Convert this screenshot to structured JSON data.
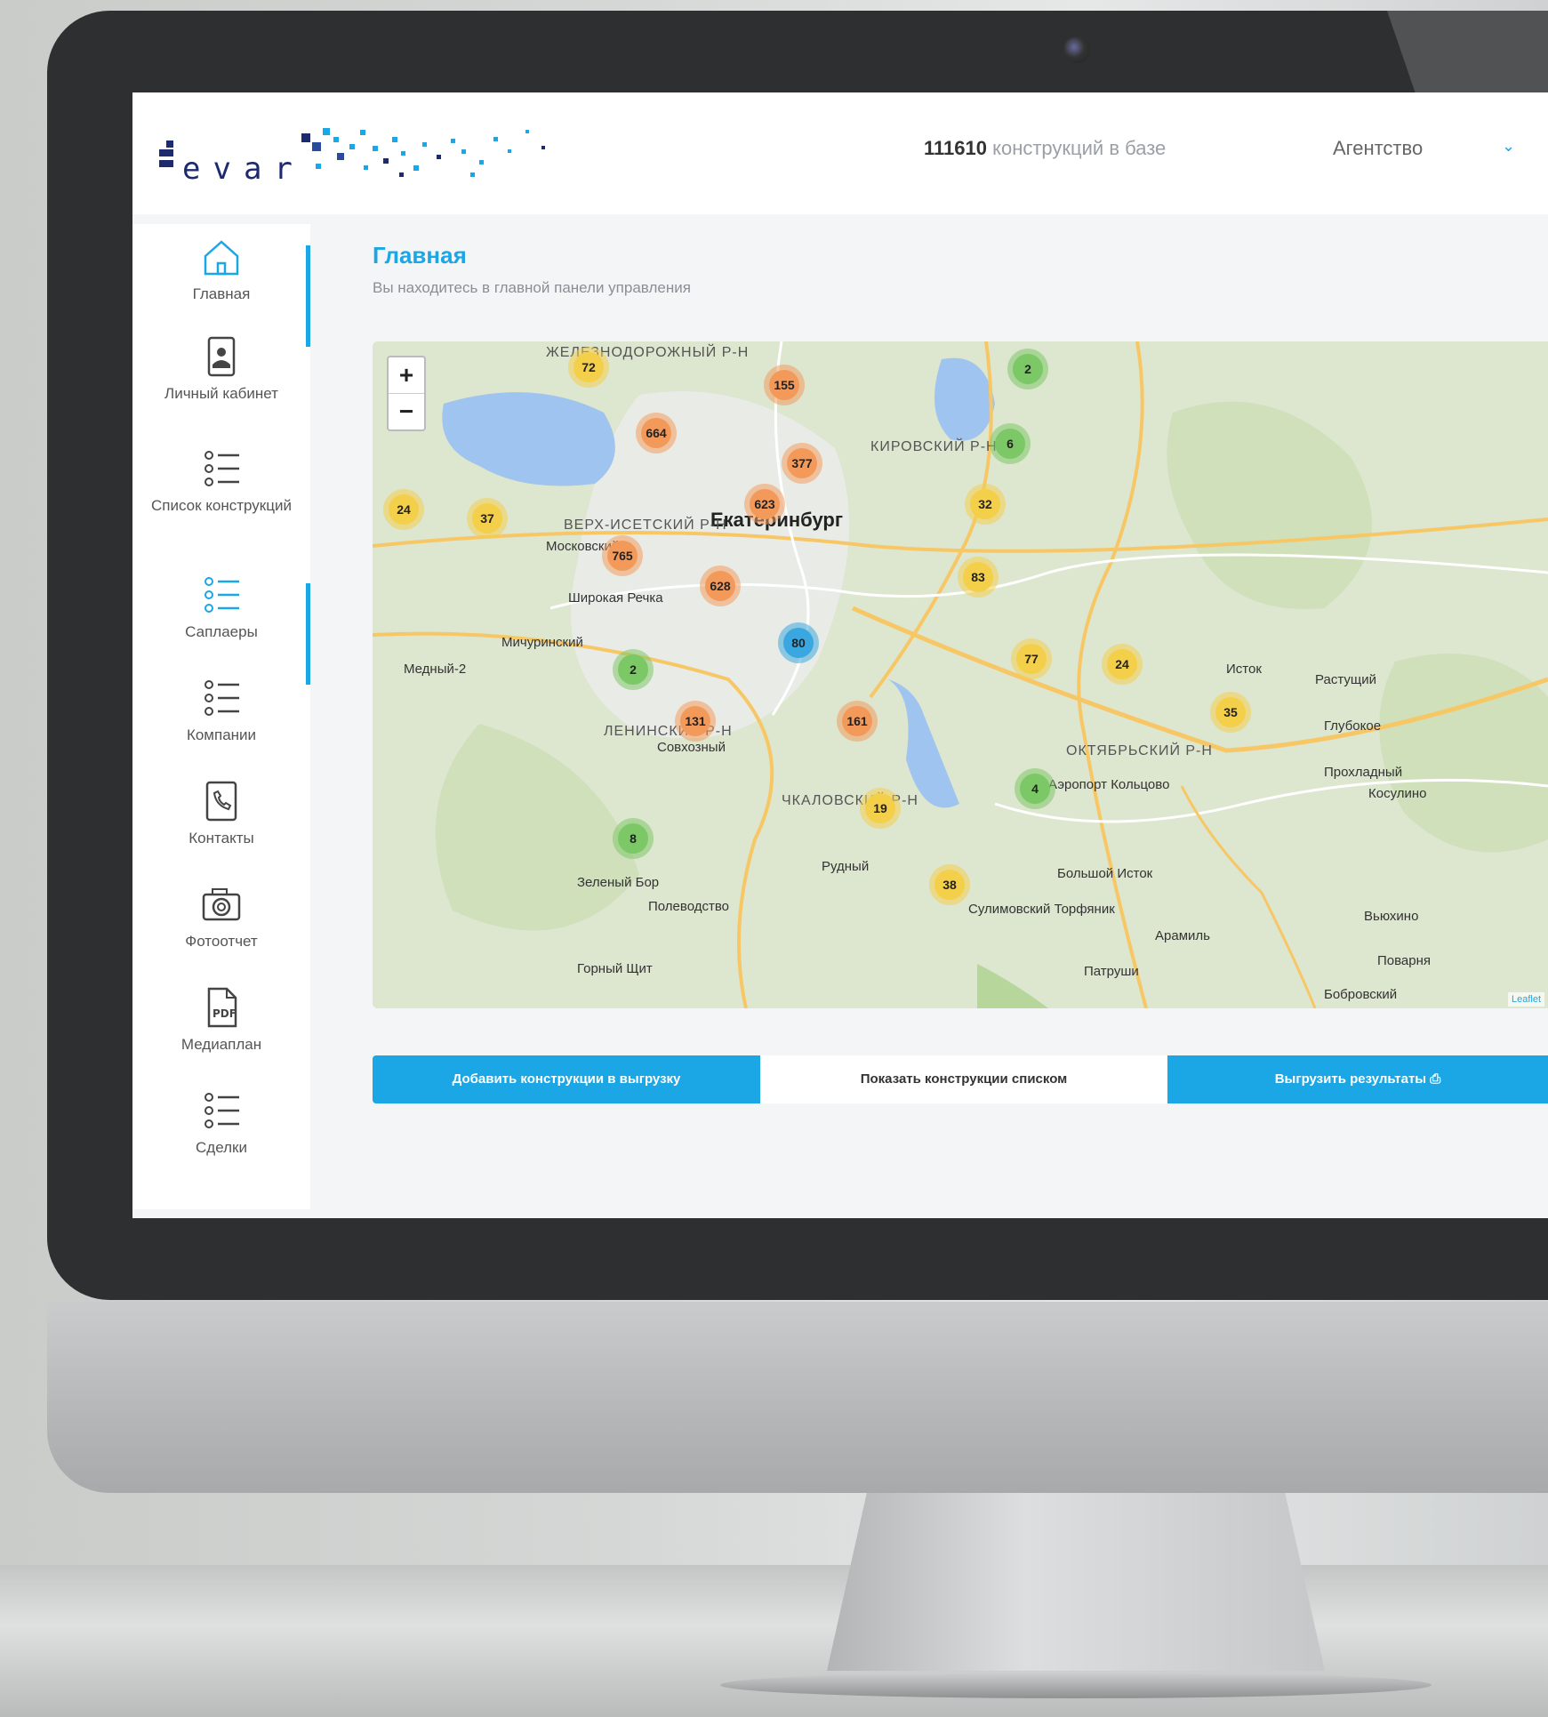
{
  "header": {
    "logo_text": "evar",
    "count_value": "111610",
    "count_label": " конструкций в базе",
    "account_label": "Агентство"
  },
  "sidebar": {
    "items": [
      {
        "label": "Главная",
        "icon": "home-icon",
        "active": true
      },
      {
        "label": "Личный кабинет",
        "icon": "profile-icon"
      },
      {
        "label": "Список конструкций",
        "icon": "checklist-icon"
      },
      {
        "label": "Саплаеры",
        "icon": "checklist-icon",
        "active": true
      },
      {
        "label": "Компании",
        "icon": "checklist-icon"
      },
      {
        "label": "Контакты",
        "icon": "phone-book-icon"
      },
      {
        "label": "Фотоотчет",
        "icon": "camera-icon"
      },
      {
        "label": "Медиаплан",
        "icon": "pdf-icon"
      },
      {
        "label": "Сделки",
        "icon": "checklist-icon"
      }
    ]
  },
  "page": {
    "title": "Главная",
    "subtitle": "Вы находитесь в главной панели управления"
  },
  "map": {
    "zoom_in": "+",
    "zoom_out": "−",
    "attribution": "Leaflet",
    "labels": [
      {
        "text": "Екатеринбург",
        "kind": "big"
      },
      {
        "text": "ЖЕЛЕЗНОДОРОЖНЫЙ Р-Н",
        "kind": "district"
      },
      {
        "text": "КИРОВСКИЙ Р-Н",
        "kind": "district"
      },
      {
        "text": "ВЕРХ-ИСЕТСКИЙ Р-Н",
        "kind": "district"
      },
      {
        "text": "ЛЕНИНСКИЙ Р-Н",
        "kind": "district"
      },
      {
        "text": "ЧКАЛОВСКИЙ Р-Н",
        "kind": "district"
      },
      {
        "text": "ОКТЯБРЬСКИЙ Р-Н",
        "kind": "district"
      },
      {
        "text": "Московский",
        "kind": "town"
      },
      {
        "text": "Широкая Речка",
        "kind": "town"
      },
      {
        "text": "Мичуринский",
        "kind": "town"
      },
      {
        "text": "Медный-2",
        "kind": "town"
      },
      {
        "text": "Совхозный",
        "kind": "town"
      },
      {
        "text": "Рудный",
        "kind": "town"
      },
      {
        "text": "Зеленый Бор",
        "kind": "town"
      },
      {
        "text": "Полеводство",
        "kind": "town"
      },
      {
        "text": "Горный Щит",
        "kind": "town"
      },
      {
        "text": "Аэропорт Кольцово",
        "kind": "town"
      },
      {
        "text": "Большой Исток",
        "kind": "town"
      },
      {
        "text": "Сулимовский Торфяник",
        "kind": "town"
      },
      {
        "text": "Арамиль",
        "kind": "town"
      },
      {
        "text": "Патруши",
        "kind": "town"
      },
      {
        "text": "Исток",
        "kind": "town"
      },
      {
        "text": "Растущий",
        "kind": "town"
      },
      {
        "text": "Глубокое",
        "kind": "town"
      },
      {
        "text": "Прохладный",
        "kind": "town"
      },
      {
        "text": "Косулино",
        "kind": "town"
      },
      {
        "text": "Вьюхино",
        "kind": "town"
      },
      {
        "text": "Поварня",
        "kind": "town"
      },
      {
        "text": "Бобровский",
        "kind": "town"
      }
    ],
    "clusters": [
      {
        "value": "72",
        "color": "yellow"
      },
      {
        "value": "155",
        "color": "orange"
      },
      {
        "value": "664",
        "color": "orange"
      },
      {
        "value": "377",
        "color": "orange"
      },
      {
        "value": "623",
        "color": "orange"
      },
      {
        "value": "24",
        "color": "yellow"
      },
      {
        "value": "37",
        "color": "yellow"
      },
      {
        "value": "765",
        "color": "orange"
      },
      {
        "value": "628",
        "color": "orange"
      },
      {
        "value": "80",
        "color": "blue"
      },
      {
        "value": "2",
        "color": "green"
      },
      {
        "value": "131",
        "color": "orange"
      },
      {
        "value": "161",
        "color": "orange"
      },
      {
        "value": "19",
        "color": "yellow"
      },
      {
        "value": "8",
        "color": "green"
      },
      {
        "value": "38",
        "color": "yellow"
      },
      {
        "value": "2",
        "color": "green"
      },
      {
        "value": "6",
        "color": "green"
      },
      {
        "value": "32",
        "color": "yellow"
      },
      {
        "value": "83",
        "color": "yellow"
      },
      {
        "value": "77",
        "color": "yellow"
      },
      {
        "value": "24",
        "color": "yellow"
      },
      {
        "value": "35",
        "color": "yellow"
      },
      {
        "value": "4",
        "color": "green"
      }
    ]
  },
  "actions": {
    "add_label": "Добавить конструкции в выгрузку",
    "show_list_label": "Показать конструкции списком",
    "export_label": "Выгрузить результаты"
  },
  "colors": {
    "accent": "#1ba7e5",
    "cluster_orange": "#f39a5b",
    "cluster_yellow": "#f4cf4a",
    "cluster_green": "#7cc766",
    "cluster_blue": "#3aa7e0"
  }
}
